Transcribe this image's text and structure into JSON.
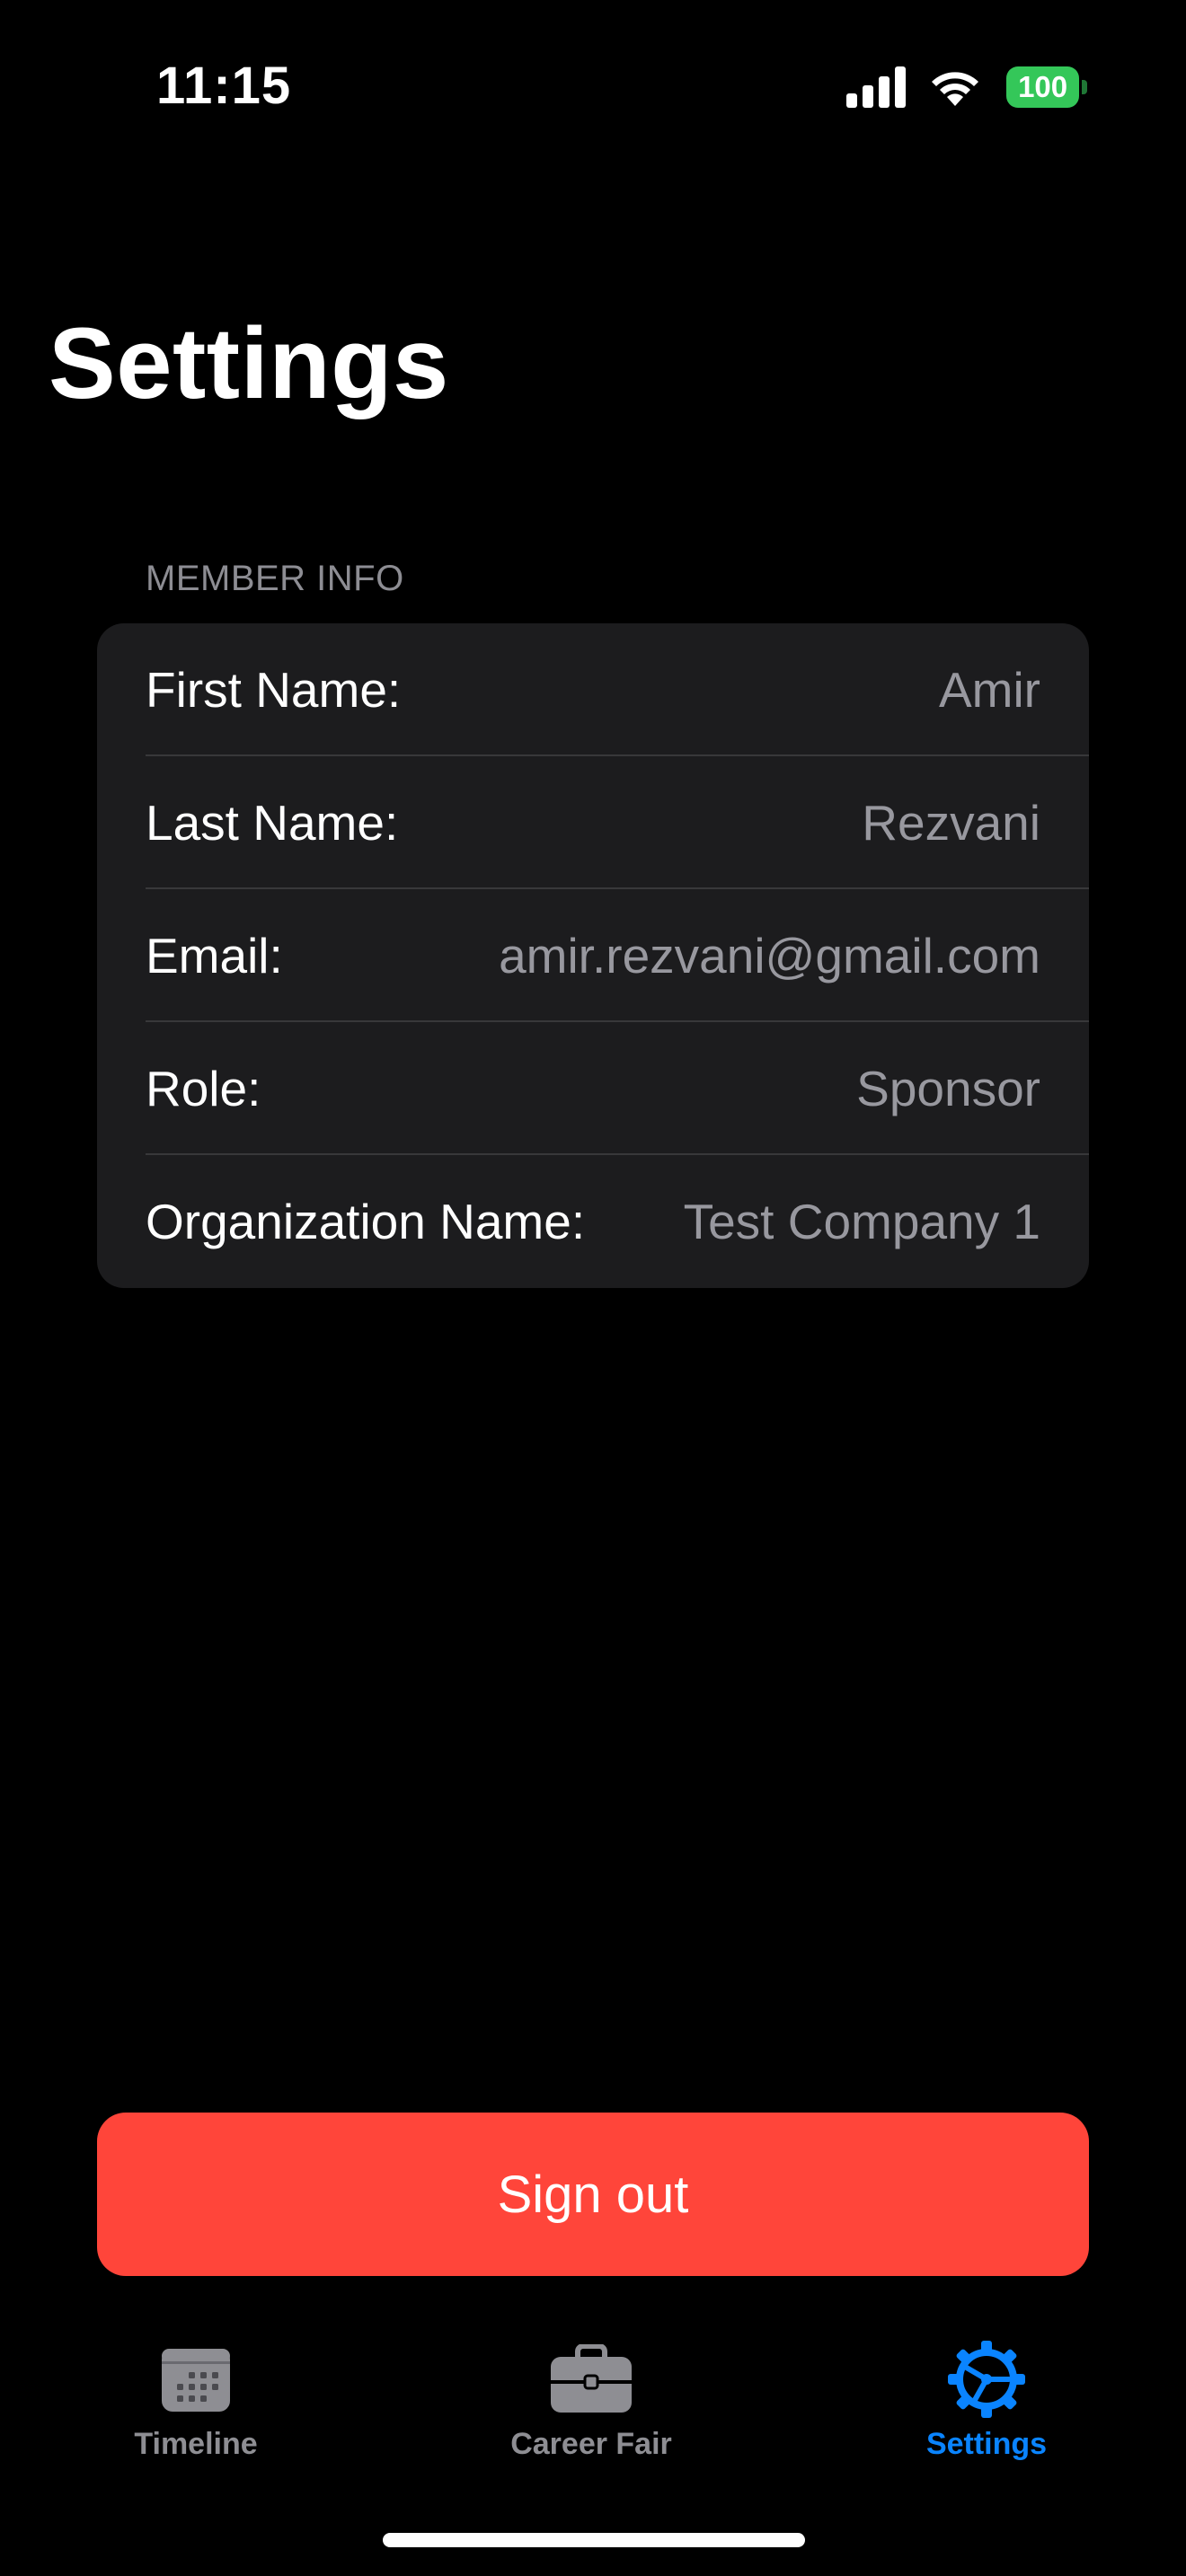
{
  "status_bar": {
    "time": "11:15",
    "battery_level": "100",
    "icons": [
      "cellular-signal-icon",
      "wifi-icon",
      "battery-icon"
    ],
    "battery_color": "#34c759"
  },
  "page": {
    "title": "Settings"
  },
  "member_info": {
    "header": "MEMBER INFO",
    "rows": [
      {
        "label": "First Name:",
        "value": "Amir"
      },
      {
        "label": "Last Name:",
        "value": "Rezvani"
      },
      {
        "label": "Email:",
        "value": "amir.rezvani@gmail.com"
      },
      {
        "label": "Role:",
        "value": "Sponsor"
      },
      {
        "label": "Organization Name:",
        "value": "Test Company 1"
      }
    ]
  },
  "actions": {
    "sign_out_label": "Sign out",
    "sign_out_color": "#ff453a"
  },
  "tab_bar": {
    "active_color": "#0a84ff",
    "inactive_color": "#8e8e93",
    "tabs": [
      {
        "label": "Timeline",
        "icon": "calendar-icon",
        "active": false
      },
      {
        "label": "Career Fair",
        "icon": "briefcase-icon",
        "active": false
      },
      {
        "label": "Settings",
        "icon": "gear-icon",
        "active": true
      }
    ]
  }
}
